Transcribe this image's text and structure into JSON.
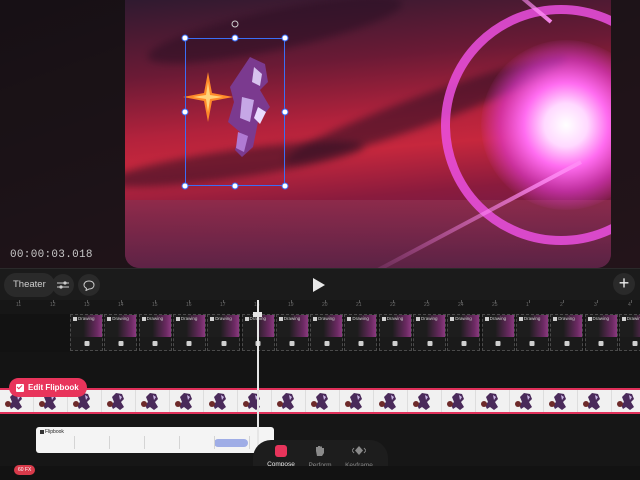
{
  "canvas": {
    "timecode": "00:00:03.018"
  },
  "toolbar": {
    "theater_label": "Theater",
    "adjust_icon": "sliders-icon",
    "comment_icon": "speech-bubble-icon",
    "play_icon": "play-icon",
    "add_icon": "plus-icon",
    "add_label": "+"
  },
  "ruler": {
    "ticks": [
      "11",
      "12",
      "13",
      "14",
      "15",
      "16",
      "17",
      "18",
      "19",
      "20",
      "21",
      "22",
      "23",
      "24",
      "25",
      "1",
      "2",
      "3",
      "4"
    ]
  },
  "drawing_track": {
    "cell_label": "Drawing",
    "cells": 17
  },
  "flipbook": {
    "edit_label": "Edit Flipbook",
    "clip_label": "Flipbook",
    "accent": "#e8345b"
  },
  "modes": {
    "items": [
      {
        "label": "Compose",
        "icon": "compose-icon",
        "active": true
      },
      {
        "label": "Perform",
        "icon": "hand-icon",
        "active": false
      },
      {
        "label": "Keyframe",
        "icon": "keyframe-icon",
        "active": false
      }
    ]
  },
  "bottom": {
    "fx_label": "60 FX"
  }
}
